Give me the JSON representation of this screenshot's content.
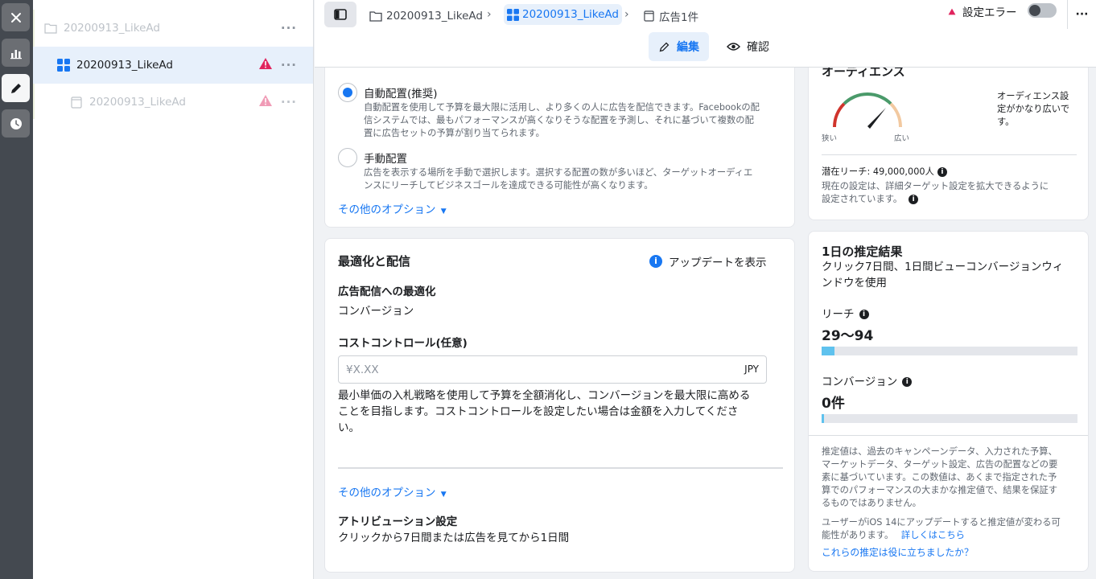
{
  "rail": {
    "close_icon": "close-icon",
    "chart_icon": "bar-chart-icon",
    "edit_icon": "pencil-icon",
    "history_icon": "clock-icon"
  },
  "tree": {
    "items": [
      {
        "label": "20200913_LikeAd",
        "type": "campaign",
        "state": "muted"
      },
      {
        "label": "20200913_LikeAd",
        "type": "adset",
        "state": "selected",
        "warning": true
      },
      {
        "label": "20200913_LikeAd",
        "type": "ad",
        "state": "muted",
        "warning": true
      }
    ]
  },
  "breadcrumb": {
    "campaign": "20200913_LikeAd",
    "adset": "20200913_LikeAd",
    "ad": "広告1件"
  },
  "header": {
    "error_label": "設定エラー",
    "edit_label": "編集",
    "review_label": "確認"
  },
  "placement": {
    "auto_label": "自動配置(推奨)",
    "auto_desc1": "自動配置を使用して予算を最大限に活用し、より多くの人に広告を配信できます。Facebookの配",
    "auto_desc2": "信システムでは、最もパフォーマンスが高くなりそうな配置を予測し、それに基づいて複数の配",
    "auto_desc3": "置に広告セットの予算が割り当てられます。",
    "manual_label": "手動配置",
    "manual_desc1": "広告を表示する場所を手動で選択します。選択する配置の数が多いほど、ターゲットオーディエ",
    "manual_desc2": "ンスにリーチしてビジネスゴールを達成できる可能性が高くなります。",
    "more_options": "その他のオプション"
  },
  "optimization": {
    "title": "最適化と配信",
    "update_link": "アップデートを表示",
    "delivery_label": "広告配信への最適化",
    "delivery_value": "コンバージョン",
    "cost_label": "コストコントロール(任意)",
    "cost_placeholder": "¥X.XX",
    "currency": "JPY",
    "cost_desc1": "最小単価の入札戦略を使用して予算を全額消化し、コンバージョンを最大限に高める",
    "cost_desc2": "ことを目指します。コストコントロールを設定したい場合は金額を入力してくださ",
    "cost_desc3": "い。",
    "more_options": "その他のオプション",
    "attribution_label": "アトリビューション設定",
    "attribution_value": "クリックから7日間または広告を見てから1日間"
  },
  "audience": {
    "title": "オーディエンス",
    "gauge_note1": "オーディエンス設",
    "gauge_note2": "定がかなり広いで",
    "gauge_note3": "す。",
    "narrow_label": "狭い",
    "broad_label": "広い",
    "reach_label": "潜在リーチ: 49,000,000人",
    "current_note1": "現在の設定は、詳細ターゲット設定を拡大できるように",
    "current_note2": "設定されています。"
  },
  "estimate": {
    "title": "1日の推定結果",
    "subtitle1": "クリック7日間、1日間ビューコンバージョンウィ",
    "subtitle2": "ンドウを使用",
    "reach_label": "リーチ",
    "reach_value": "29〜94",
    "reach_fill": 0.05,
    "conv_label": "コンバージョン",
    "conv_value": "0件",
    "conv_fill": 0.01,
    "note1": "推定値は、過去のキャンペーンデータ、入力された予算、",
    "note2": "マーケットデータ、ターゲット設定、広告の配置などの要",
    "note3": "素に基づいています。この数値は、あくまで指定された予",
    "note4": "算でのパフォーマンスの大まかな推定値で、結果を保証す",
    "note5": "るものではありません。",
    "ios1": "ユーザーがiOS 14にアップデートすると推定値が変わる可",
    "ios2": "能性があります。",
    "ios_link": "詳しくはこちら",
    "feedback_link": "これらの推定は役に立ちましたか？"
  },
  "colors": {
    "accent": "#1877f2",
    "warning": "#e0245e",
    "bar_fill": "#5fc2ee"
  }
}
